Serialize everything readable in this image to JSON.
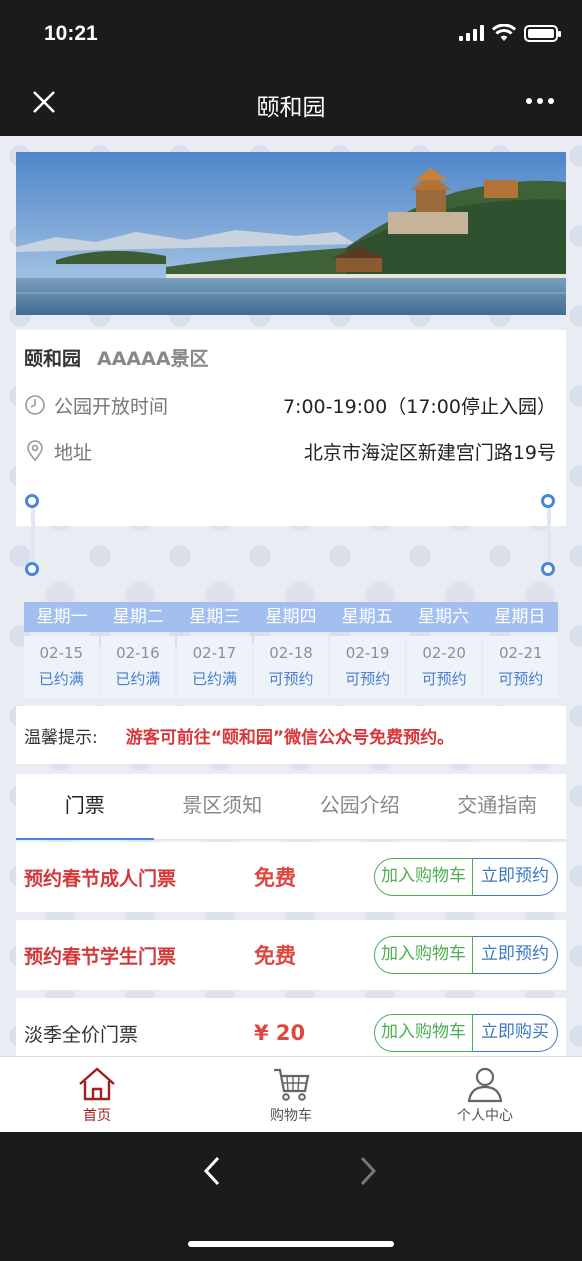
{
  "status": {
    "time": "10:21"
  },
  "nav": {
    "title": "颐和园"
  },
  "park": {
    "name": "颐和园",
    "level": "AAAAA景区",
    "hours_label": "公园开放时间",
    "hours_value": "7:00-19:00（17:00停止入园）",
    "address_label": "地址",
    "address_value": "北京市海淀区新建宫门路19号"
  },
  "calendar": {
    "weekdays": [
      "星期一",
      "星期二",
      "星期三",
      "星期四",
      "星期五",
      "星期六",
      "星期日"
    ],
    "days": [
      {
        "date": "02-15",
        "status": "已约满"
      },
      {
        "date": "02-16",
        "status": "已约满"
      },
      {
        "date": "02-17",
        "status": "已约满"
      },
      {
        "date": "02-18",
        "status": "可预约"
      },
      {
        "date": "02-19",
        "status": "可预约"
      },
      {
        "date": "02-20",
        "status": "可预约"
      },
      {
        "date": "02-21",
        "status": "可预约"
      }
    ]
  },
  "tip": {
    "label": "温馨提示:",
    "message": "游客可前往“颐和园”微信公众号免费预约。"
  },
  "tabs": [
    "门票",
    "景区须知",
    "公园介绍",
    "交通指南"
  ],
  "tickets": [
    {
      "name": "预约春节成人门票",
      "price": "免费",
      "cart": "加入购物车",
      "action": "立即预约"
    },
    {
      "name": "预约春节学生门票",
      "price": "免费",
      "cart": "加入购物车",
      "action": "立即预约"
    },
    {
      "name": "淡季全价门票",
      "price": "¥ 20",
      "cart": "加入购物车",
      "action": "立即购买"
    }
  ],
  "tabbar": [
    {
      "label": "首页",
      "icon": "home-icon"
    },
    {
      "label": "购物车",
      "icon": "cart-icon"
    },
    {
      "label": "个人中心",
      "icon": "user-icon"
    }
  ],
  "colors": {
    "accent_red": "#d4373a",
    "accent_blue": "#4a86d8",
    "cart_green": "#4caf50"
  }
}
